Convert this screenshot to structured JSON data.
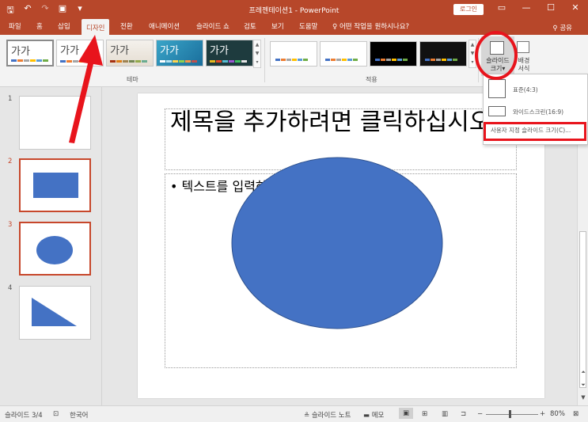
{
  "app": {
    "title": "프레젠테이션1  -  PowerPoint",
    "login_label": "로그인",
    "share_label": "공유",
    "qat": {
      "save": "🖫",
      "undo": "↶",
      "redo": "↷",
      "present": "▣",
      "customize": "▾"
    },
    "window": {
      "ribbon_options": "▭",
      "minimize": "—",
      "maximize": "☐",
      "close": "✕"
    }
  },
  "tabs": [
    {
      "label": "파일"
    },
    {
      "label": "홈"
    },
    {
      "label": "삽입"
    },
    {
      "label": "디자인",
      "active": true
    },
    {
      "label": "전환"
    },
    {
      "label": "애니메이션"
    },
    {
      "label": "슬라이드 쇼"
    },
    {
      "label": "검토"
    },
    {
      "label": "보기"
    },
    {
      "label": "도움말"
    }
  ],
  "tell_me": "어떤 작업을 원하시나요?",
  "ribbon": {
    "themes_group": "테마",
    "variants_group": "적용",
    "theme_sample_text": "가가",
    "slide_size_label_1": "슬라이드",
    "slide_size_label_2": "크기",
    "background_label_1": "배경",
    "background_label_2": "서식"
  },
  "slide_size_menu": {
    "standard": "표준(4:3)",
    "widescreen": "와이드스크린(16:9)",
    "custom": "사용자 지정 슬라이드 크기(C)..."
  },
  "thumbnails": [
    {
      "number": "1",
      "selected": false,
      "shape": "none"
    },
    {
      "number": "2",
      "selected": true,
      "shape": "rectangle"
    },
    {
      "number": "3",
      "selected": true,
      "shape": "ellipse"
    },
    {
      "number": "4",
      "selected": false,
      "shape": "right-triangle"
    }
  ],
  "slide": {
    "title_placeholder": "제목을 추가하려면 클릭하십시오.",
    "body_placeholder": "• 텍스트를 입력하십시오"
  },
  "status": {
    "slide_counter": "슬라이드 3/4",
    "language": "한국어",
    "notes": "슬라이드 노트",
    "comments": "메모",
    "zoom": "80%"
  },
  "colors": {
    "accent": "#b7472a",
    "shape_fill": "#4472c4",
    "shape_stroke": "#2f528f",
    "annotation": "#e8141c"
  }
}
